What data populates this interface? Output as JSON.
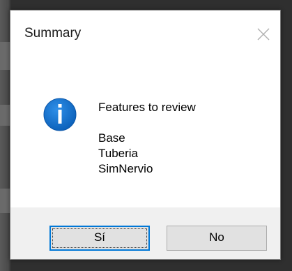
{
  "dialog": {
    "title": "Summary",
    "close_icon": "close-icon",
    "info_icon": "info-icon",
    "info_icon_color": "#0a6fd1",
    "message": {
      "heading": "Features to review",
      "items": [
        "Base",
        "Tuberia",
        "SimNervio"
      ]
    },
    "buttons": {
      "yes_label": "Sí",
      "no_label": "No"
    },
    "accent": "#0078d7"
  }
}
